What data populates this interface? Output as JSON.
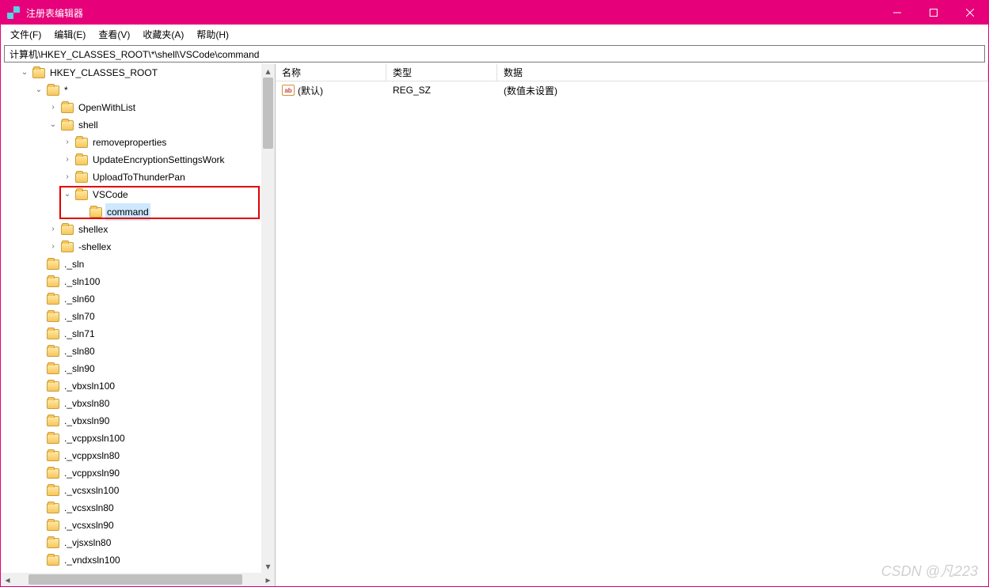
{
  "window": {
    "title": "注册表编辑器"
  },
  "menu": {
    "file": "文件(F)",
    "edit": "编辑(E)",
    "view": "查看(V)",
    "fav": "收藏夹(A)",
    "help": "帮助(H)"
  },
  "address": "计算机\\HKEY_CLASSES_ROOT\\*\\shell\\VSCode\\command",
  "columns": {
    "name": "名称",
    "type": "类型",
    "data": "数据"
  },
  "value_row": {
    "icon": "ab",
    "name": "(默认)",
    "type": "REG_SZ",
    "data": "(数值未设置)"
  },
  "tree": {
    "root": "HKEY_CLASSES_ROOT",
    "star": "*",
    "openwith": "OpenWithList",
    "shell": "shell",
    "removeprops": "removeproperties",
    "updateenc": "UpdateEncryptionSettingsWork",
    "uploadthunder": "UploadToThunderPan",
    "vscode": "VSCode",
    "command": "command",
    "shellex": "shellex",
    "neg_shellex": "-shellex",
    "keys": [
      "._sln",
      "._sln100",
      "._sln60",
      "._sln70",
      "._sln71",
      "._sln80",
      "._sln90",
      "._vbxsln100",
      "._vbxsln80",
      "._vbxsln90",
      "._vcppxsln100",
      "._vcppxsln80",
      "._vcppxsln90",
      "._vcsxsln100",
      "._vcsxsln80",
      "._vcsxsln90",
      "._vjsxsln80",
      "._vndxsln100"
    ]
  },
  "watermark": "CSDN @凡223"
}
